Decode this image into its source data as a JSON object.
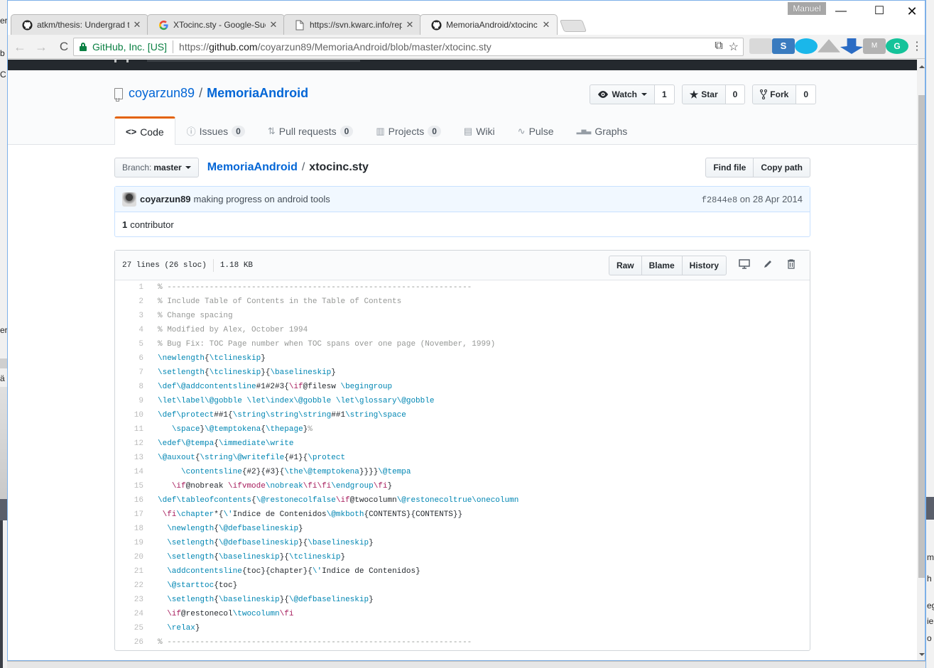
{
  "desktop": {
    "left_fragments": [
      "er",
      "b",
      "C",
      "er",
      "ä"
    ],
    "right_fragments": [
      "m",
      "h",
      "eg",
      "ie",
      "o"
    ]
  },
  "browser": {
    "profile_name": "Manuel",
    "window_controls": {
      "minimize": "—",
      "maximize": "☐",
      "close": "✕"
    },
    "tabs": [
      {
        "title": "atkm/thesis: Undergrad t",
        "icon": "github-icon",
        "active": false
      },
      {
        "title": "XTocinc.sty - Google-Suc",
        "icon": "google-icon",
        "active": false
      },
      {
        "title": "https://svn.kwarc.info/rep",
        "icon": "document-icon",
        "active": false
      },
      {
        "title": "MemoriaAndroid/xtocinc",
        "icon": "github-icon",
        "active": true
      }
    ],
    "tab_close": "✕",
    "nav": {
      "back": "←",
      "forward": "→",
      "reload": "C"
    },
    "omnibox": {
      "ev_label": "GitHub, Inc. [US]",
      "url_scheme": "https://",
      "url_host": "github.com",
      "url_path": "/coyarzun89/MemoriaAndroid/blob/master/xtocinc.sty",
      "translate_icon": "⧉",
      "star_icon": "☆"
    },
    "extensions": [
      {
        "name": "pdf-extension-icon",
        "color": "#d9d9d9"
      },
      {
        "name": "s-extension-icon",
        "color": "#3a7bbf"
      },
      {
        "name": "share-extension-icon",
        "color": "#1ab7ea"
      },
      {
        "name": "drive-extension-icon",
        "color": "#b8b8b8"
      },
      {
        "name": "download-extension-icon",
        "color": "#2b6cc4"
      },
      {
        "name": "m-extension-icon",
        "color": "#b3b3b3"
      },
      {
        "name": "grammarly-extension-icon",
        "color": "#15c39a"
      }
    ],
    "menu_icon": "⋮"
  },
  "repo": {
    "owner": "coyarzun89",
    "name": "MemoriaAndroid",
    "slash": "/",
    "actions": {
      "watch_label": "Watch",
      "watch_count": "1",
      "star_label": "Star",
      "star_count": "0",
      "fork_label": "Fork",
      "fork_count": "0"
    },
    "nav": [
      {
        "label": "Code",
        "icon": "<>",
        "count": null,
        "selected": true
      },
      {
        "label": "Issues",
        "icon": "ⓘ",
        "count": "0"
      },
      {
        "label": "Pull requests",
        "icon": "⇅",
        "count": "0"
      },
      {
        "label": "Projects",
        "icon": "▥",
        "count": "0"
      },
      {
        "label": "Wiki",
        "icon": "▤",
        "count": null
      },
      {
        "label": "Pulse",
        "icon": "∿",
        "count": null
      },
      {
        "label": "Graphs",
        "icon": "▂▅▃",
        "count": null
      }
    ]
  },
  "filenav": {
    "branch_prefix": "Branch:",
    "branch_name": "master",
    "breadcrumb_repo": "MemoriaAndroid",
    "breadcrumb_file": "xtocinc.sty",
    "find_file": "Find file",
    "copy_path": "Copy path"
  },
  "commit": {
    "author": "coyarzun89",
    "message": "making progress on android tools",
    "sha": "f2844e8",
    "date_text": "on 28 Apr 2014",
    "contributors_count": "1",
    "contributors_label": "contributor"
  },
  "file": {
    "lines_info": "27 lines (26 sloc)",
    "size": "1.18 KB",
    "raw": "Raw",
    "blame": "Blame",
    "history": "History",
    "icons": {
      "desktop": "🖵",
      "edit": "✎",
      "delete": "🗑"
    },
    "code_lines": [
      [
        [
          "c",
          "% -----------------------------------------------------------------"
        ]
      ],
      [
        [
          "c",
          "% Include Table of Contents in the Table of Contents"
        ]
      ],
      [
        [
          "c",
          "% Change spacing"
        ]
      ],
      [
        [
          "c",
          "% Modified by Alex, October 1994"
        ]
      ],
      [
        [
          "c",
          "% Bug Fix: TOC Page number when TOC spans over one page (November, 1999)"
        ]
      ],
      [
        [
          "f",
          "\\newlength"
        ],
        [
          "p",
          "{"
        ],
        [
          "f",
          "\\tclineskip"
        ],
        [
          "p",
          "}"
        ]
      ],
      [
        [
          "f",
          "\\setlength"
        ],
        [
          "p",
          "{"
        ],
        [
          "f",
          "\\tclineskip"
        ],
        [
          "p",
          "}{"
        ],
        [
          "f",
          "\\baselineskip"
        ],
        [
          "p",
          "}"
        ]
      ],
      [
        [
          "f",
          "\\def\\@addcontentsline"
        ],
        [
          "p",
          "#1#2#3{"
        ],
        [
          "k",
          "\\if"
        ],
        [
          "p",
          "@filesw "
        ],
        [
          "f",
          "\\begingroup"
        ]
      ],
      [
        [
          "f",
          "\\let\\label\\@gobble \\let\\index\\@gobble \\let\\glossary\\@gobble"
        ]
      ],
      [
        [
          "f",
          "\\def\\protect"
        ],
        [
          "p",
          "##1{"
        ],
        [
          "f",
          "\\string\\string\\string"
        ],
        [
          "p",
          "##1"
        ],
        [
          "f",
          "\\string\\space"
        ]
      ],
      [
        [
          "p",
          "   "
        ],
        [
          "f",
          "\\space"
        ],
        [
          "p",
          "}"
        ],
        [
          "f",
          "\\@temptokena"
        ],
        [
          "p",
          "{"
        ],
        [
          "f",
          "\\thepage"
        ],
        [
          "p",
          "}"
        ],
        [
          "c",
          "%"
        ]
      ],
      [
        [
          "f",
          "\\edef\\@tempa"
        ],
        [
          "p",
          "{"
        ],
        [
          "f",
          "\\immediate\\write"
        ]
      ],
      [
        [
          "f",
          "\\@auxout"
        ],
        [
          "p",
          "{"
        ],
        [
          "f",
          "\\string\\@writefile"
        ],
        [
          "p",
          "{#1}{"
        ],
        [
          "f",
          "\\protect"
        ]
      ],
      [
        [
          "p",
          "     "
        ],
        [
          "f",
          "\\contentsline"
        ],
        [
          "p",
          "{#2}{#3}{"
        ],
        [
          "f",
          "\\the\\@temptokena"
        ],
        [
          "p",
          "}}}}"
        ],
        [
          "f",
          "\\@tempa"
        ]
      ],
      [
        [
          "p",
          "   "
        ],
        [
          "k",
          "\\if"
        ],
        [
          "p",
          "@nobreak "
        ],
        [
          "k",
          "\\ifvmode"
        ],
        [
          "f",
          "\\nobreak"
        ],
        [
          "k",
          "\\fi\\fi"
        ],
        [
          "f",
          "\\endgroup"
        ],
        [
          "k",
          "\\fi"
        ],
        [
          "p",
          "}"
        ]
      ],
      [
        [
          "f",
          "\\def\\tableofcontents"
        ],
        [
          "p",
          "{"
        ],
        [
          "f",
          "\\@restonecolfalse"
        ],
        [
          "k",
          "\\if"
        ],
        [
          "p",
          "@twocolumn"
        ],
        [
          "f",
          "\\@restonecoltrue\\onecolumn"
        ]
      ],
      [
        [
          "p",
          " "
        ],
        [
          "k",
          "\\fi"
        ],
        [
          "f",
          "\\chapter"
        ],
        [
          "p",
          "*{"
        ],
        [
          "f",
          "\\'"
        ],
        [
          "p",
          "Indice de Contenidos"
        ],
        [
          "f",
          "\\@mkboth"
        ],
        [
          "p",
          "{CONTENTS}{CONTENTS}}"
        ]
      ],
      [
        [
          "p",
          "  "
        ],
        [
          "f",
          "\\newlength"
        ],
        [
          "p",
          "{"
        ],
        [
          "f",
          "\\@defbaselineskip"
        ],
        [
          "p",
          "}"
        ]
      ],
      [
        [
          "p",
          "  "
        ],
        [
          "f",
          "\\setlength"
        ],
        [
          "p",
          "{"
        ],
        [
          "f",
          "\\@defbaselineskip"
        ],
        [
          "p",
          "}{"
        ],
        [
          "f",
          "\\baselineskip"
        ],
        [
          "p",
          "}"
        ]
      ],
      [
        [
          "p",
          "  "
        ],
        [
          "f",
          "\\setlength"
        ],
        [
          "p",
          "{"
        ],
        [
          "f",
          "\\baselineskip"
        ],
        [
          "p",
          "}{"
        ],
        [
          "f",
          "\\tclineskip"
        ],
        [
          "p",
          "}"
        ]
      ],
      [
        [
          "p",
          "  "
        ],
        [
          "f",
          "\\addcontentsline"
        ],
        [
          "p",
          "{toc}{chapter}{"
        ],
        [
          "f",
          "\\'"
        ],
        [
          "p",
          "Indice de Contenidos}"
        ]
      ],
      [
        [
          "p",
          "  "
        ],
        [
          "f",
          "\\@starttoc"
        ],
        [
          "p",
          "{toc}"
        ]
      ],
      [
        [
          "p",
          "  "
        ],
        [
          "f",
          "\\setlength"
        ],
        [
          "p",
          "{"
        ],
        [
          "f",
          "\\baselineskip"
        ],
        [
          "p",
          "}{"
        ],
        [
          "f",
          "\\@defbaselineskip"
        ],
        [
          "p",
          "}"
        ]
      ],
      [
        [
          "p",
          "  "
        ],
        [
          "k",
          "\\if"
        ],
        [
          "p",
          "@restonecol"
        ],
        [
          "f",
          "\\twocolumn"
        ],
        [
          "k",
          "\\fi"
        ]
      ],
      [
        [
          "p",
          "  "
        ],
        [
          "f",
          "\\relax"
        ],
        [
          "p",
          "}"
        ]
      ],
      [
        [
          "c",
          "% -----------------------------------------------------------------"
        ]
      ]
    ]
  }
}
